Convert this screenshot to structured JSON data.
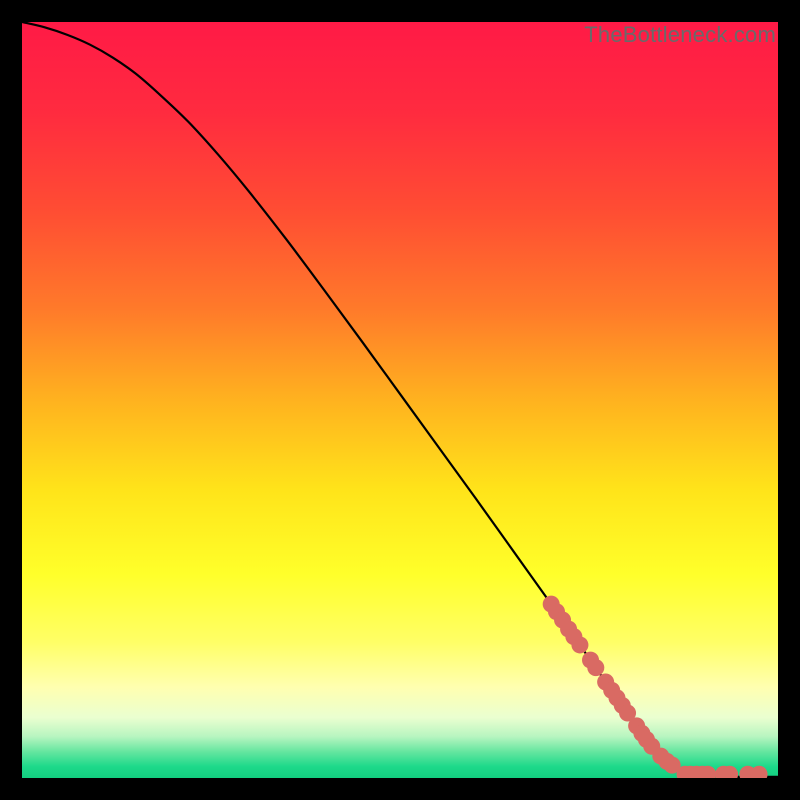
{
  "watermark": "TheBottleneck.com",
  "colors": {
    "frame": "#000000",
    "gradient_stops": [
      {
        "offset": 0.0,
        "color": "#ff1a46"
      },
      {
        "offset": 0.12,
        "color": "#ff2b3f"
      },
      {
        "offset": 0.25,
        "color": "#ff4d33"
      },
      {
        "offset": 0.38,
        "color": "#ff7a2a"
      },
      {
        "offset": 0.5,
        "color": "#ffb21f"
      },
      {
        "offset": 0.62,
        "color": "#ffe41a"
      },
      {
        "offset": 0.73,
        "color": "#ffff2a"
      },
      {
        "offset": 0.82,
        "color": "#ffff66"
      },
      {
        "offset": 0.88,
        "color": "#ffffb0"
      },
      {
        "offset": 0.92,
        "color": "#eaffd0"
      },
      {
        "offset": 0.945,
        "color": "#b8f5c0"
      },
      {
        "offset": 0.965,
        "color": "#66e6a0"
      },
      {
        "offset": 0.985,
        "color": "#1dd98a"
      },
      {
        "offset": 1.0,
        "color": "#13cf80"
      }
    ],
    "curve": "#000000",
    "marker_fill": "#d96a63",
    "marker_stroke": "#b9534c"
  },
  "chart_data": {
    "type": "line",
    "title": "",
    "xlabel": "",
    "ylabel": "",
    "xlim": [
      0,
      100
    ],
    "ylim": [
      0,
      100
    ],
    "series": [
      {
        "name": "curve",
        "x": [
          0,
          3,
          6,
          9,
          12,
          15,
          18,
          22,
          26,
          30,
          35,
          40,
          45,
          50,
          55,
          60,
          65,
          70,
          74,
          77,
          80,
          82,
          84,
          86,
          89,
          92,
          95,
          100
        ],
        "y": [
          100,
          99.3,
          98.3,
          97,
          95.3,
          93.2,
          90.6,
          86.8,
          82.4,
          77.6,
          71.2,
          64.5,
          57.7,
          50.8,
          43.9,
          37,
          30,
          23,
          17.3,
          13,
          8.7,
          5.9,
          3.5,
          1.7,
          0.6,
          0.25,
          0.15,
          0.15
        ]
      }
    ],
    "markers": {
      "name": "highlighted-points",
      "points": [
        {
          "x": 70.0,
          "y": 23.0
        },
        {
          "x": 70.7,
          "y": 22.0
        },
        {
          "x": 71.5,
          "y": 20.9
        },
        {
          "x": 72.3,
          "y": 19.7
        },
        {
          "x": 73.0,
          "y": 18.7
        },
        {
          "x": 73.8,
          "y": 17.6
        },
        {
          "x": 75.2,
          "y": 15.6
        },
        {
          "x": 75.9,
          "y": 14.6
        },
        {
          "x": 77.2,
          "y": 12.7
        },
        {
          "x": 78.0,
          "y": 11.6
        },
        {
          "x": 78.7,
          "y": 10.6
        },
        {
          "x": 79.4,
          "y": 9.6
        },
        {
          "x": 80.1,
          "y": 8.6
        },
        {
          "x": 81.3,
          "y": 6.9
        },
        {
          "x": 82.0,
          "y": 5.9
        },
        {
          "x": 82.6,
          "y": 5.1
        },
        {
          "x": 83.3,
          "y": 4.2
        },
        {
          "x": 84.5,
          "y": 2.9
        },
        {
          "x": 85.3,
          "y": 2.2
        },
        {
          "x": 86.0,
          "y": 1.7
        },
        {
          "x": 87.7,
          "y": 0.5
        },
        {
          "x": 88.4,
          "y": 0.5
        },
        {
          "x": 89.2,
          "y": 0.5
        },
        {
          "x": 90.0,
          "y": 0.5
        },
        {
          "x": 90.7,
          "y": 0.5
        },
        {
          "x": 92.8,
          "y": 0.5
        },
        {
          "x": 93.6,
          "y": 0.5
        },
        {
          "x": 96.0,
          "y": 0.5
        },
        {
          "x": 97.5,
          "y": 0.5
        }
      ]
    }
  }
}
